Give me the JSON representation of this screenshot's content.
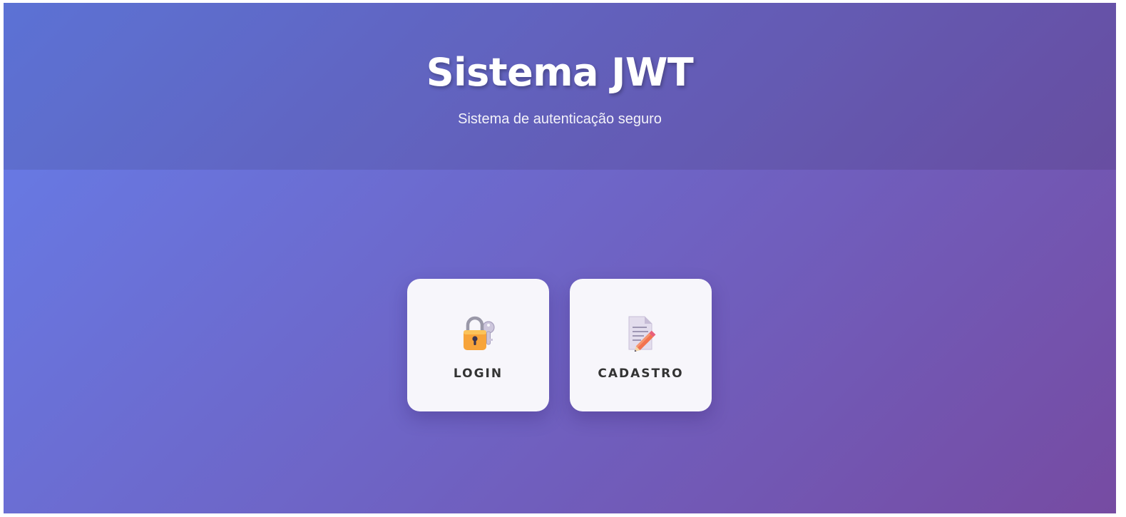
{
  "header": {
    "title": "Sistema JWT",
    "subtitle": "Sistema de autenticação seguro"
  },
  "cards": [
    {
      "label": "LOGIN",
      "icon": "lock-with-key-icon"
    },
    {
      "label": "CADASTRO",
      "icon": "memo-pencil-icon"
    }
  ],
  "colors": {
    "gradient_start": "#667eea",
    "gradient_end": "#764ba2",
    "card_background": "#f7f6fb",
    "card_text": "#333333"
  }
}
